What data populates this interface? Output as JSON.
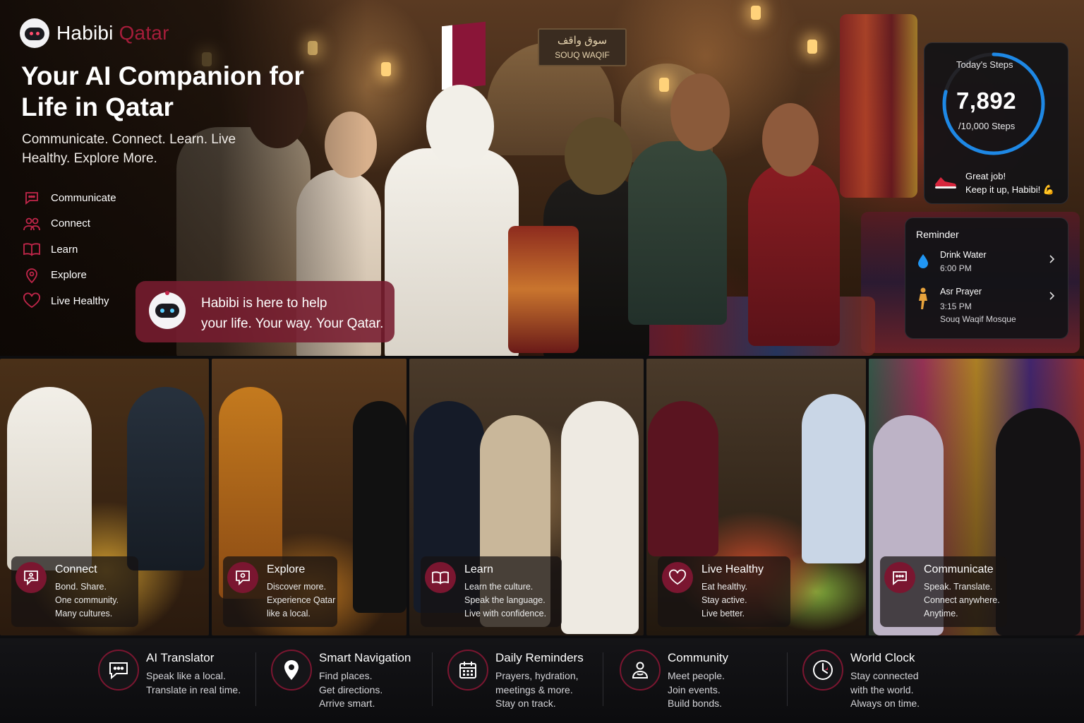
{
  "brand": {
    "name_part1": "Habibi",
    "name_part2": "Qatar"
  },
  "hero": {
    "headline": "Your AI Companion for Life in Qatar",
    "subline": "Communicate. Connect. Learn. Live Healthy. Explore More.",
    "sign_arabic": "سوق واقف",
    "sign_latin": "SOUQ WAQIF"
  },
  "menu": [
    {
      "label": "Communicate",
      "icon": "chat-bubble-icon"
    },
    {
      "label": "Connect",
      "icon": "people-icon"
    },
    {
      "label": "Learn",
      "icon": "book-icon"
    },
    {
      "label": "Explore",
      "icon": "map-pin-icon"
    },
    {
      "label": "Live Healthy",
      "icon": "heart-icon"
    }
  ],
  "help": {
    "line1": "Habibi is here to help",
    "line2": "your life. Your way. Your Qatar."
  },
  "steps": {
    "label": "Today's Steps",
    "value": "7,892",
    "goal": "/10,000 Steps",
    "progress": 0.7892,
    "message_line1": "Great job!",
    "message_line2": "Keep it up, Habibi! 💪"
  },
  "reminder": {
    "title": "Reminder",
    "items": [
      {
        "title": "Drink Water",
        "time": "6:00 PM",
        "place": "",
        "icon": "water-drop-icon"
      },
      {
        "title": "Asr Prayer",
        "time": "3:15 PM",
        "place": "Souq Waqif Mosque",
        "icon": "prayer-icon"
      }
    ]
  },
  "tiles": [
    {
      "title": "Connect",
      "desc": "Bond. Share.\nOne community.\nMany cultures.",
      "icon": "chat-people-icon"
    },
    {
      "title": "Explore",
      "desc": "Discover more.\nExperience Qatar\nlike a local.",
      "icon": "explore-icon"
    },
    {
      "title": "Learn",
      "desc": "Learn the culture.\nSpeak the language.\nLive with confidence.",
      "icon": "book-icon"
    },
    {
      "title": "Live Healthy",
      "desc": "Eat healthy.\nStay active.\nLive better.",
      "icon": "heart-icon"
    },
    {
      "title": "Communicate",
      "desc": "Speak. Translate.\nConnect anywhere.\nAnytime.",
      "icon": "chat-bubble-icon"
    }
  ],
  "features": [
    {
      "title": "AI Translator",
      "desc": "Speak like a local.\nTranslate in real time.",
      "icon": "translate-chat-icon"
    },
    {
      "title": "Smart Navigation",
      "desc": "Find places.\nGet directions.\nArrive smart.",
      "icon": "location-pin-icon"
    },
    {
      "title": "Daily Reminders",
      "desc": "Prayers, hydration,\nmeetings & more.\nStay on track.",
      "icon": "calendar-icon"
    },
    {
      "title": "Community",
      "desc": "Meet people.\nJoin events.\nBuild bonds.",
      "icon": "community-icon"
    },
    {
      "title": "World Clock",
      "desc": "Stay connected\nwith the world.\nAlways on time.",
      "icon": "clock-icon"
    }
  ],
  "colors": {
    "accent": "#7a1630",
    "brand_maroon": "#a51d3a",
    "ring": "#1e88e5"
  }
}
